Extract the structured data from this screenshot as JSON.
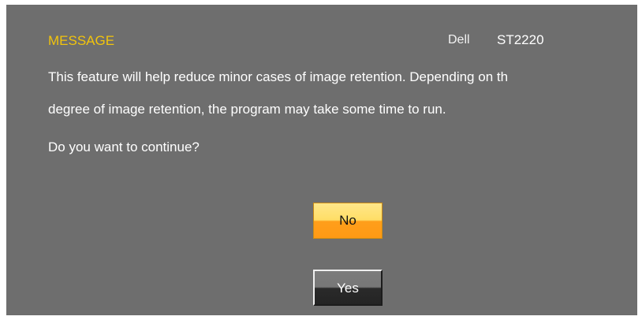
{
  "header": {
    "title": "MESSAGE",
    "brand": "Dell",
    "model": "ST2220"
  },
  "message": {
    "line1": "This feature will help reduce minor cases of image retention. Depending on th",
    "line2": "degree of image retention, the program may take some time to run.",
    "line3": "Do you want to continue?"
  },
  "buttons": {
    "no": "No",
    "yes": "Yes"
  },
  "colors": {
    "panel": "#6e6e6e",
    "title": "#f2c40c",
    "selected_button": "#ffb02a"
  }
}
